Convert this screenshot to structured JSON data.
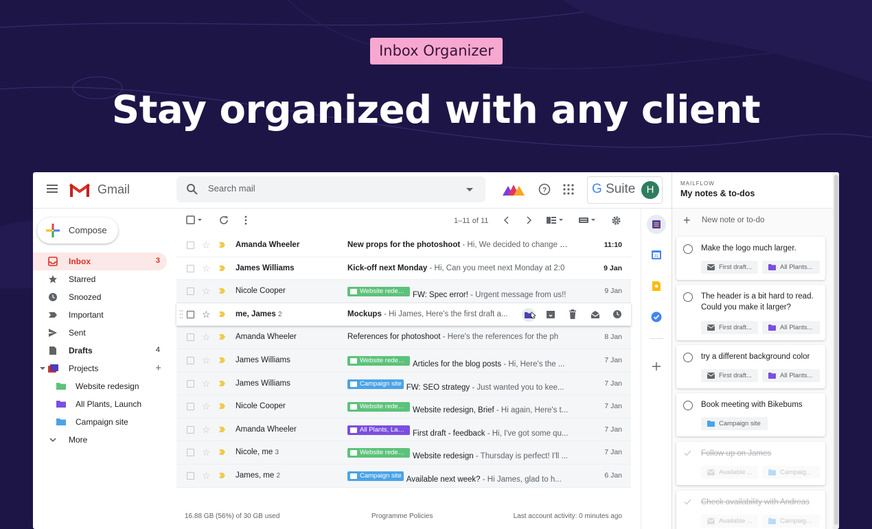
{
  "hero": {
    "badge": "Inbox Organizer",
    "headline": "Stay organized with any client"
  },
  "gmail": {
    "app_name": "Gmail",
    "search_placeholder": "Search mail",
    "gsuite_g": "G",
    "gsuite_suite": "Suite",
    "avatar_initial": "H",
    "compose_label": "Compose",
    "pager": "1–11 of 11",
    "nav": [
      {
        "label": "Inbox",
        "count": "3"
      },
      {
        "label": "Starred",
        "count": ""
      },
      {
        "label": "Snoozed",
        "count": ""
      },
      {
        "label": "Important",
        "count": ""
      },
      {
        "label": "Sent",
        "count": ""
      },
      {
        "label": "Drafts",
        "count": "4"
      },
      {
        "label": "Projects",
        "count": ""
      },
      {
        "label": "Website redesign",
        "count": ""
      },
      {
        "label": "All Plants, Launch",
        "count": ""
      },
      {
        "label": "Campaign site",
        "count": ""
      },
      {
        "label": "More",
        "count": ""
      }
    ],
    "emails": [
      {
        "sender": "Amanda Wheeler",
        "count": "",
        "label": "",
        "label_color": "",
        "subject": "New props for the photoshoot",
        "snippet": " - Hi, We decided to change some",
        "date": "11:10",
        "unread": true
      },
      {
        "sender": "James Williams",
        "count": "",
        "label": "",
        "label_color": "",
        "subject": "Kick-off next Monday",
        "snippet": " - Hi, Can you meet next Monday at 2:0",
        "date": "9 Jan",
        "unread": true
      },
      {
        "sender": "Nicole Cooper",
        "count": "",
        "label": "Website redesign",
        "label_color": "#5cc27a",
        "subject": "FW: Spec error!",
        "snippet": " - Urgent message from us!!",
        "date": "9 Jan",
        "unread": false
      },
      {
        "sender": "me, James",
        "count": "2",
        "label": "",
        "label_color": "",
        "subject": "Mockups",
        "snippet": " - Hi James, Here's the first draft a...",
        "date": "",
        "unread": true
      },
      {
        "sender": "Amanda Wheeler",
        "count": "",
        "label": "",
        "label_color": "",
        "subject": "References for photoshoot",
        "snippet": " - Here's the references for the ph",
        "date": "8 Jan",
        "unread": false
      },
      {
        "sender": "James Williams",
        "count": "",
        "label": "Website redesign",
        "label_color": "#5cc27a",
        "subject": "Articles for the blog posts",
        "snippet": " - Hi, Here's the ...",
        "date": "7 Jan",
        "unread": false
      },
      {
        "sender": "James Williams",
        "count": "",
        "label": "Campaign site",
        "label_color": "#4aa3e6",
        "subject": "FW: SEO strategy",
        "snippet": " - Just wanted you to kee...",
        "date": "7 Jan",
        "unread": false
      },
      {
        "sender": "Nicole Cooper",
        "count": "",
        "label": "Website redesign",
        "label_color": "#5cc27a",
        "subject": "Website redesign, Brief",
        "snippet": " - Hi again, Here's t...",
        "date": "7 Jan",
        "unread": false
      },
      {
        "sender": "Amanda Wheeler",
        "count": "",
        "label": "All Plants, Launch",
        "label_color": "#7a4fe0",
        "subject": "First draft - feedback",
        "snippet": " - Hi, I've got some qu...",
        "date": "7 Jan",
        "unread": false
      },
      {
        "sender": "Nicole, me",
        "count": "3",
        "label": "Website redesign",
        "label_color": "#5cc27a",
        "subject": "Website redesign",
        "snippet": " - Thursday is perfect! I'll ...",
        "date": "7 Jan",
        "unread": false
      },
      {
        "sender": "James, me",
        "count": "2",
        "label": "Campaign site",
        "label_color": "#4aa3e6",
        "subject": "Available next week?",
        "snippet": " - Hi James, glad to h...",
        "date": "6 Jan",
        "unread": false
      }
    ],
    "footer": {
      "storage": "16.88 GB (56%) of 30 GB used",
      "policies": "Programme Policies",
      "activity": "Last account activity: 0 minutes ago"
    }
  },
  "mailflow": {
    "brand": "MAILFLOW",
    "title": "My notes & to-dos",
    "new_note": "New note or to-do",
    "notes": [
      {
        "text": "Make the logo much larger.",
        "chips": [
          {
            "label": "First draft...",
            "icon": "mail-icon"
          },
          {
            "label": "All Plants...",
            "icon": "folder-icon",
            "color": "#7a4fe0"
          }
        ]
      },
      {
        "text": "The header is a bit hard to read. Could you make it larger?",
        "chips": [
          {
            "label": "First draft...",
            "icon": "mail-icon"
          },
          {
            "label": "All Plants...",
            "icon": "folder-icon",
            "color": "#7a4fe0"
          }
        ]
      },
      {
        "text": "try a different background color",
        "chips": [
          {
            "label": "First draft...",
            "icon": "mail-icon"
          },
          {
            "label": "All Plants...",
            "icon": "folder-icon",
            "color": "#7a4fe0"
          }
        ]
      },
      {
        "text": "Book meeting with Bikebums",
        "chips": [
          {
            "label": "Campaign site",
            "icon": "folder-icon",
            "color": "#4aa3e6"
          }
        ]
      },
      {
        "text": "Follow up on James",
        "chips": [
          {
            "label": "Available ...",
            "icon": "mail-icon"
          },
          {
            "label": "Campaig...",
            "icon": "folder-icon",
            "color": "#b9dcf5"
          }
        ]
      },
      {
        "text": "Check availability with Andreas",
        "chips": [
          {
            "label": "Available ...",
            "icon": "mail-icon"
          },
          {
            "label": "Campaig...",
            "icon": "folder-icon",
            "color": "#b9dcf5"
          }
        ]
      }
    ]
  },
  "colors": {
    "background": "#1e1547",
    "badge": "#f7a8d0",
    "accent_red": "#d93025"
  }
}
